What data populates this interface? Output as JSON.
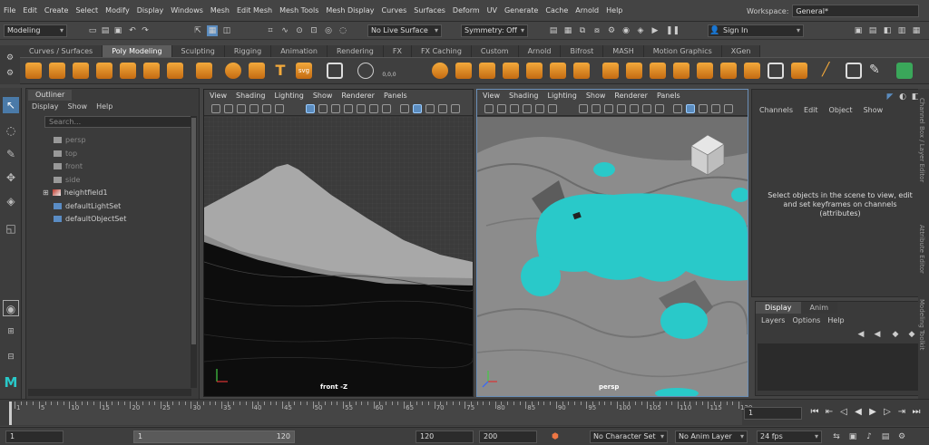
{
  "menubar": [
    "File",
    "Edit",
    "Create",
    "Select",
    "Modify",
    "Display",
    "Windows",
    "Mesh",
    "Edit Mesh",
    "Mesh Tools",
    "Mesh Display",
    "Curves",
    "Surfaces",
    "Deform",
    "UV",
    "Generate",
    "Cache",
    "Arnold",
    "Help"
  ],
  "workspace": {
    "label": "Workspace:",
    "value": "General*"
  },
  "status": {
    "mode": "Modeling",
    "live_surface": "No Live Surface",
    "symmetry": "Symmetry: Off",
    "sign_in": "Sign In"
  },
  "shelf_tabs": [
    "Curves / Surfaces",
    "Poly Modeling",
    "Sculpting",
    "Rigging",
    "Animation",
    "Rendering",
    "FX",
    "FX Caching",
    "Custom",
    "Arnold",
    "Bifrost",
    "MASH",
    "Motion Graphics",
    "XGen"
  ],
  "shelf_active": "Poly Modeling",
  "shelf_icon_text": {
    "text_tool": "T",
    "svg_tool": "svg",
    "coords": "0,0,0"
  },
  "outliner": {
    "title": "Outliner",
    "menu": [
      "Display",
      "Show",
      "Help"
    ],
    "search_placeholder": "Search...",
    "items": [
      {
        "label": "persp",
        "dim": true
      },
      {
        "label": "top",
        "dim": true
      },
      {
        "label": "front",
        "dim": true
      },
      {
        "label": "side",
        "dim": true
      },
      {
        "label": "heightfield1",
        "dim": false
      },
      {
        "label": "defaultLightSet",
        "dim": false
      },
      {
        "label": "defaultObjectSet",
        "dim": false
      }
    ]
  },
  "viewport_menu": [
    "View",
    "Shading",
    "Lighting",
    "Show",
    "Renderer",
    "Panels"
  ],
  "viewport_left": {
    "camera": "front -Z"
  },
  "viewport_right": {
    "camera": "persp"
  },
  "channel_box": {
    "menu": [
      "Channels",
      "Edit",
      "Object",
      "Show"
    ],
    "message": "Select objects in the scene to view, edit and set keyframes on channels (attributes)"
  },
  "layer_editor": {
    "tabs": [
      "Display",
      "Anim"
    ],
    "menu": [
      "Layers",
      "Options",
      "Help"
    ]
  },
  "side_tabs": [
    "Channel Box / Layer Editor",
    "Attribute Editor",
    "Modeling Toolkit"
  ],
  "timeline": {
    "ticks": [
      1,
      5,
      10,
      15,
      20,
      25,
      30,
      35,
      40,
      45,
      50,
      55,
      60,
      65,
      70,
      75,
      80,
      85,
      90,
      95,
      100,
      105,
      110,
      115,
      120
    ],
    "current_frame": "1"
  },
  "range": {
    "start": "1",
    "slider_start": "1",
    "slider_end": "120",
    "end": "120",
    "anim_end": "200",
    "character_set": "No Character Set",
    "anim_layer": "No Anim Layer",
    "fps": "24 fps"
  },
  "colors": {
    "accent": "#5b8cbf",
    "water": "#29c9c9",
    "orange_icon": "#f3a93b"
  }
}
